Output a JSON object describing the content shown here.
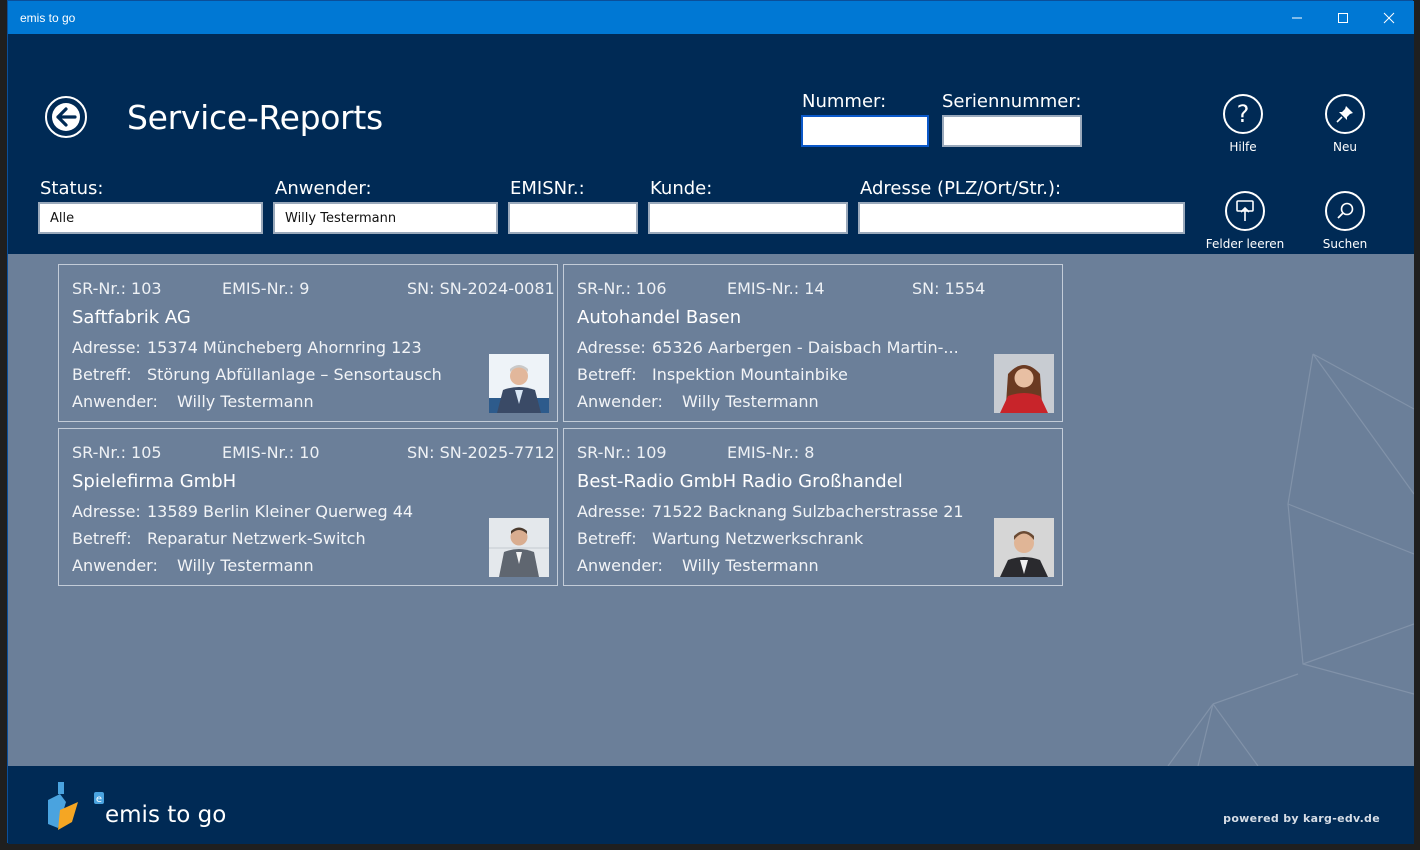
{
  "window": {
    "title": "emis to go"
  },
  "header": {
    "page_title": "Service-Reports",
    "fields": {
      "nummer": {
        "label": "Nummer:",
        "value": ""
      },
      "seriennummer": {
        "label": "Seriennummer:",
        "value": ""
      },
      "status": {
        "label": "Status:",
        "value": "Alle"
      },
      "anwender": {
        "label": "Anwender:",
        "value": "Willy Testermann"
      },
      "emisnr": {
        "label": "EMISNr.:",
        "value": ""
      },
      "kunde": {
        "label": "Kunde:",
        "value": ""
      },
      "adresse": {
        "label": "Adresse (PLZ/Ort/Str.):",
        "value": ""
      }
    },
    "actions": {
      "hilfe": "Hilfe",
      "neu": "Neu",
      "felder_leeren": "Felder leeren",
      "suchen": "Suchen"
    }
  },
  "reports": [
    {
      "sr": "SR-Nr.: 103",
      "emis": "EMIS-Nr.: 9",
      "sn": "SN: SN-2024-0081",
      "kunde": "Saftfabrik AG",
      "adresse_label": "Adresse:",
      "adresse": "15374 Müncheberg Ahornring 123",
      "betreff_label": "Betreff:",
      "betreff": "Störung Abfüllanlage – Sensortausch",
      "anwender_label": "Anwender:",
      "anwender": "Willy Testermann"
    },
    {
      "sr": "SR-Nr.: 106",
      "emis": "EMIS-Nr.: 14",
      "sn": "SN: 1554",
      "kunde": "Autohandel Basen",
      "adresse_label": "Adresse:",
      "adresse": "65326 Aarbergen - Daisbach Martin-...",
      "betreff_label": "Betreff:",
      "betreff": "Inspektion Mountainbike",
      "anwender_label": "Anwender:",
      "anwender": "Willy Testermann"
    },
    {
      "sr": "SR-Nr.: 105",
      "emis": "EMIS-Nr.: 10",
      "sn": "SN: SN-2025-7712",
      "kunde": "Spielefirma GmbH",
      "adresse_label": "Adresse:",
      "adresse": "13589 Berlin Kleiner Querweg 44",
      "betreff_label": "Betreff:",
      "betreff": "Reparatur Netzwerk-Switch",
      "anwender_label": "Anwender:",
      "anwender": "Willy Testermann"
    },
    {
      "sr": "SR-Nr.: 109",
      "emis": "EMIS-Nr.: 8",
      "sn": "",
      "kunde": "Best-Radio GmbH Radio Großhandel",
      "adresse_label": "Adresse:",
      "adresse": "71522 Backnang Sulzbacherstrasse 21",
      "betreff_label": "Betreff:",
      "betreff": "Wartung Netzwerkschrank",
      "anwender_label": "Anwender:",
      "anwender": "Willy Testermann"
    }
  ],
  "footer": {
    "logo_text": "emis to go",
    "powered_by": "powered by karg-edv.de"
  },
  "colors": {
    "titlebar": "#0078d4",
    "header_bg": "#002a55",
    "content_bg": "#6b7f99",
    "card_border": "#c3ccd8"
  }
}
